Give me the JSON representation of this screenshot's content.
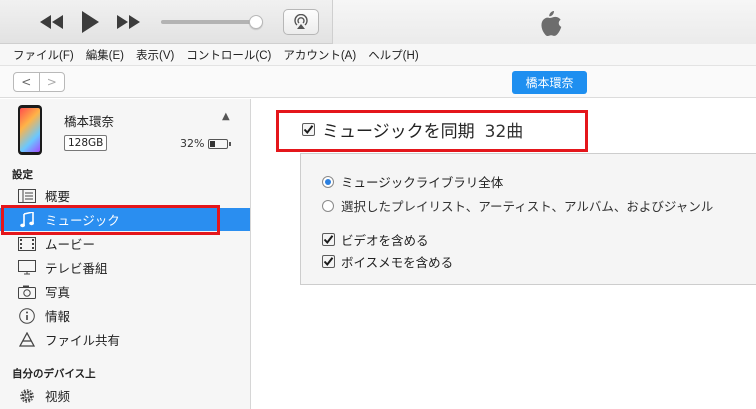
{
  "menu": [
    "ファイル(F)",
    "編集(E)",
    "表示(V)",
    "コントロール(C)",
    "アカウント(A)",
    "ヘルプ(H)"
  ],
  "nav": {
    "back": "<",
    "forward": ">",
    "device_button": "橋本環奈"
  },
  "device": {
    "name": "橋本環奈",
    "capacity": "128GB",
    "battery": "32%",
    "battery_level": 0.32
  },
  "sidebar": {
    "settings_header": "設定",
    "settings_items": [
      {
        "label": "概要",
        "icon": "summary-icon"
      },
      {
        "label": "ミュージック",
        "icon": "music-note-icon",
        "selected": true
      },
      {
        "label": "ムービー",
        "icon": "movie-icon"
      },
      {
        "label": "テレビ番組",
        "icon": "tv-icon"
      },
      {
        "label": "写真",
        "icon": "camera-icon"
      },
      {
        "label": "情報",
        "icon": "info-icon"
      },
      {
        "label": "ファイル共有",
        "icon": "file-sharing-icon"
      }
    ],
    "on_device_header": "自分のデバイス上",
    "on_device_items": [
      {
        "label": "视频",
        "icon": "gear-icon"
      }
    ]
  },
  "main": {
    "sync_label": "ミュージックを同期",
    "sync_count": "32曲",
    "sync_checked": true,
    "options": {
      "entire_library": "ミュージックライブラリ全体",
      "selected": "選択したプレイリスト、アーティスト、アルバム、およびジャンル",
      "include_videos": "ビデオを含める",
      "include_voice_memos": "ボイスメモを含める"
    }
  },
  "colors": {
    "accent": "#2a8ef0",
    "highlight": "#e4161b"
  }
}
